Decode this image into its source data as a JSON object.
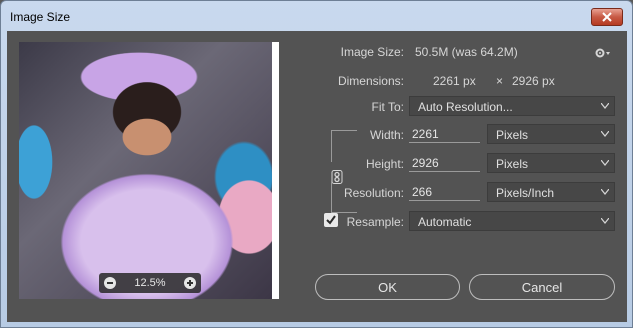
{
  "window": {
    "title": "Image Size"
  },
  "preview": {
    "zoom": "12.5%"
  },
  "info": {
    "image_size_label": "Image Size:",
    "image_size_value": "50.5M (was 64.2M)",
    "dimensions_label": "Dimensions:",
    "dimensions_w": "2261 px",
    "dimensions_x": "×",
    "dimensions_h": "2926 px"
  },
  "fit_to": {
    "label": "Fit To:",
    "value": "Auto Resolution..."
  },
  "width": {
    "label": "Width:",
    "value": "2261",
    "unit": "Pixels"
  },
  "height": {
    "label": "Height:",
    "value": "2926",
    "unit": "Pixels"
  },
  "resolution": {
    "label": "Resolution:",
    "value": "266",
    "unit": "Pixels/Inch"
  },
  "resample": {
    "label": "Resample:",
    "checked": true,
    "value": "Automatic"
  },
  "buttons": {
    "ok": "OK",
    "cancel": "Cancel"
  },
  "colors": {
    "panel": "#535353",
    "close_button": "#c75a44",
    "text": "#d6d6d6"
  },
  "icons": [
    "close-icon",
    "gear-icon",
    "chevron-down-icon",
    "link-icon",
    "zoom-out-icon",
    "zoom-in-icon",
    "check-icon"
  ]
}
